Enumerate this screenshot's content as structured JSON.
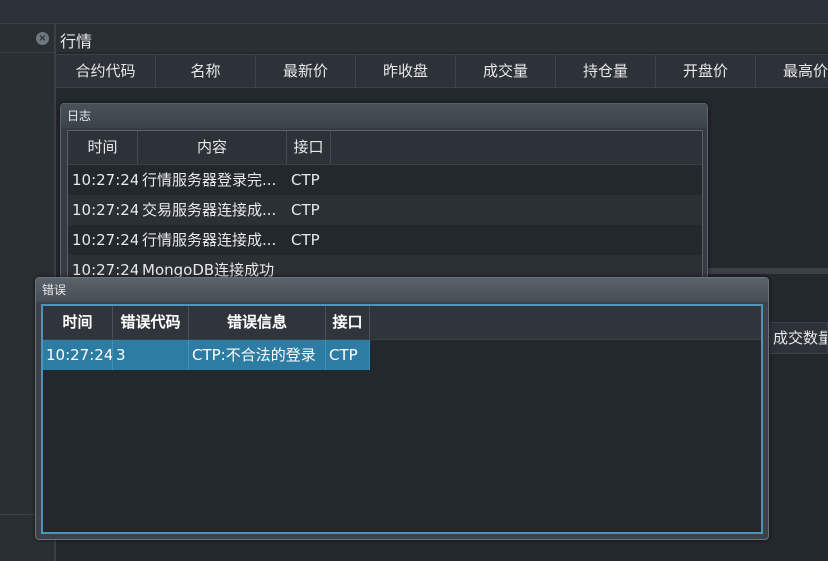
{
  "dock": {
    "title": "行情"
  },
  "market_table": {
    "columns": [
      "合约代码",
      "名称",
      "最新价",
      "昨收盘",
      "成交量",
      "持仓量",
      "开盘价",
      "最高价"
    ]
  },
  "trade_table": {
    "partial_header": "成交数量"
  },
  "log_window": {
    "title": "日志",
    "columns": [
      "时间",
      "内容",
      "接口"
    ],
    "rows": [
      {
        "time": "10:27:24",
        "content": "行情服务器登录完...",
        "gateway": "CTP"
      },
      {
        "time": "10:27:24",
        "content": "交易服务器连接成...",
        "gateway": "CTP"
      },
      {
        "time": "10:27:24",
        "content": "行情服务器连接成...",
        "gateway": "CTP"
      },
      {
        "time": "10:27:24",
        "content": "MongoDB连接成功",
        "gateway": ""
      }
    ]
  },
  "error_window": {
    "title": "错误",
    "columns": [
      "时间",
      "错误代码",
      "错误信息",
      "接口"
    ],
    "rows": [
      {
        "time": "10:27:24",
        "code": "3",
        "message": "CTP:不合法的登录",
        "gateway": "CTP"
      }
    ]
  },
  "colors": {
    "selection": "#2c7ca3",
    "focus_border": "#4d94b8",
    "background": "#23282d"
  }
}
